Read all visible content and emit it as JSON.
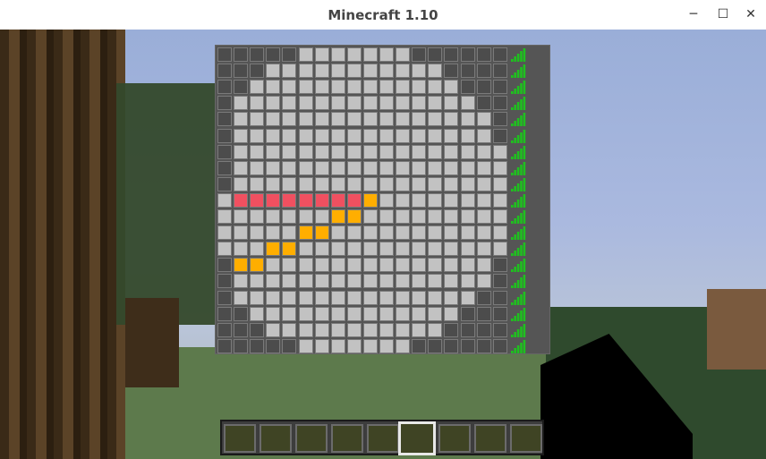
{
  "window": {
    "title": "Minecraft 1.10",
    "minimize_icon": "─",
    "maximize_icon": "☐",
    "close_icon": "✕"
  },
  "board": {
    "rows": 19,
    "cols": 19,
    "border_ring": [
      "DDDDDLLLLLLLDDDDDD",
      "DDDLLLLLLLLLLLDDDD",
      "DDLLLLLLLLLLLLLDDD",
      "DLLLLLLLLLLLLLLLDD",
      "DLLLLLLLLLLLLLLLLD",
      "DLLLLLLLLLLLLLLLLD"
    ],
    "red_cells": [
      [
        9,
        1
      ],
      [
        9,
        2
      ],
      [
        9,
        3
      ],
      [
        9,
        4
      ],
      [
        9,
        5
      ],
      [
        9,
        6
      ],
      [
        9,
        7
      ],
      [
        9,
        8
      ]
    ],
    "orange_cells": [
      [
        9,
        9
      ],
      [
        10,
        7
      ],
      [
        10,
        8
      ],
      [
        11,
        5
      ],
      [
        11,
        6
      ],
      [
        12,
        3
      ],
      [
        12,
        4
      ],
      [
        13,
        1
      ],
      [
        13,
        2
      ]
    ],
    "signal_rows": 19,
    "colors": {
      "dark": "#4c4c4c",
      "light": "#c2c2c2",
      "red": "#f05060",
      "orange": "#ffae00",
      "signal": "#1fc01f",
      "frame": "#555555"
    }
  },
  "hotbar": {
    "slots": 9,
    "selected": 5
  }
}
